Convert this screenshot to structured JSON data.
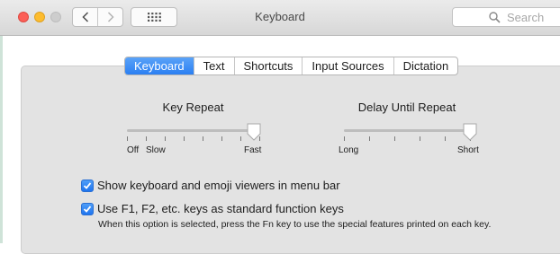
{
  "window": {
    "title": "Keyboard"
  },
  "search": {
    "placeholder": "Search"
  },
  "tabs": [
    {
      "label": "Keyboard",
      "selected": true
    },
    {
      "label": "Text",
      "selected": false
    },
    {
      "label": "Shortcuts",
      "selected": false
    },
    {
      "label": "Input Sources",
      "selected": false
    },
    {
      "label": "Dictation",
      "selected": false
    }
  ],
  "key_repeat": {
    "title": "Key Repeat",
    "min_label": "Off",
    "slow_label": "Slow",
    "max_label": "Fast",
    "tick_count": 8,
    "value": 1.0
  },
  "delay_until_repeat": {
    "title": "Delay Until Repeat",
    "min_label": "Long",
    "max_label": "Short",
    "tick_count": 6,
    "value": 1.0
  },
  "options": {
    "emoji_viewers": {
      "label": "Show keyboard and emoji viewers in menu bar",
      "checked": true
    },
    "function_keys": {
      "label": "Use F1, F2, etc. keys as standard function keys",
      "checked": true,
      "hint": "When this option is selected, press the Fn key to use the special features printed on each key."
    }
  },
  "colors": {
    "accent": "#2b7ff2",
    "close": "#fc5f57",
    "minimize": "#fdbc2e",
    "zoom": "#cdcdcd"
  }
}
